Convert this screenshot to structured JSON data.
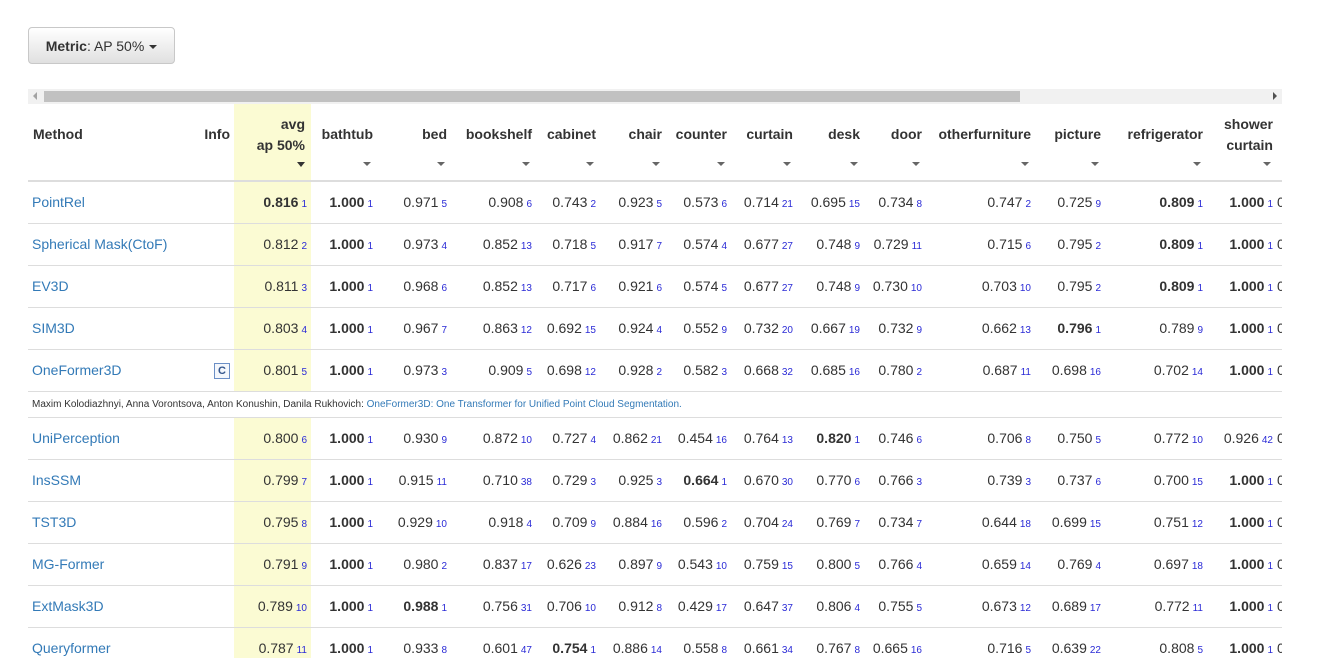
{
  "metric": {
    "label": "Metric",
    "value": ": AP 50%"
  },
  "headers": {
    "method": "Method",
    "info": "Info",
    "avg_l1": "avg",
    "avg_l2": "ap 50%",
    "bathtub": "bathtub",
    "bed": "bed",
    "bookshelf": "bookshelf",
    "cabinet": "cabinet",
    "chair": "chair",
    "counter": "counter",
    "curtain": "curtain",
    "desk": "desk",
    "door": "door",
    "otherfurniture": "otherfurniture",
    "picture": "picture",
    "refrigerator": "refrigerator",
    "shower_l1": "shower",
    "shower_l2": "curtain"
  },
  "rows": [
    {
      "method": "PointRel",
      "info": "",
      "avg": "0.816",
      "avg_r": "1",
      "bathtub": "1.000",
      "bathtub_r": "1",
      "bed": "0.971",
      "bed_r": "5",
      "bookshelf": "0.908",
      "bookshelf_r": "6",
      "cabinet": "0.743",
      "cabinet_r": "2",
      "chair": "0.923",
      "chair_r": "5",
      "counter": "0.573",
      "counter_r": "6",
      "curtain": "0.714",
      "curtain_r": "21",
      "desk": "0.695",
      "desk_r": "15",
      "door": "0.734",
      "door_r": "8",
      "otherfurniture": "0.747",
      "otherfurniture_r": "2",
      "picture": "0.725",
      "picture_r": "9",
      "refrigerator": "0.809",
      "refrigerator_r": "1",
      "shower": "1.000",
      "shower_r": "1",
      "cut": "0"
    },
    {
      "method": "Spherical Mask(CtoF)",
      "info": "",
      "avg": "0.812",
      "avg_r": "2",
      "bathtub": "1.000",
      "bathtub_r": "1",
      "bed": "0.973",
      "bed_r": "4",
      "bookshelf": "0.852",
      "bookshelf_r": "13",
      "cabinet": "0.718",
      "cabinet_r": "5",
      "chair": "0.917",
      "chair_r": "7",
      "counter": "0.574",
      "counter_r": "4",
      "curtain": "0.677",
      "curtain_r": "27",
      "desk": "0.748",
      "desk_r": "9",
      "door": "0.729",
      "door_r": "11",
      "otherfurniture": "0.715",
      "otherfurniture_r": "6",
      "picture": "0.795",
      "picture_r": "2",
      "refrigerator": "0.809",
      "refrigerator_r": "1",
      "shower": "1.000",
      "shower_r": "1",
      "cut": "0"
    },
    {
      "method": "EV3D",
      "info": "",
      "avg": "0.811",
      "avg_r": "3",
      "bathtub": "1.000",
      "bathtub_r": "1",
      "bed": "0.968",
      "bed_r": "6",
      "bookshelf": "0.852",
      "bookshelf_r": "13",
      "cabinet": "0.717",
      "cabinet_r": "6",
      "chair": "0.921",
      "chair_r": "6",
      "counter": "0.574",
      "counter_r": "5",
      "curtain": "0.677",
      "curtain_r": "27",
      "desk": "0.748",
      "desk_r": "9",
      "door": "0.730",
      "door_r": "10",
      "otherfurniture": "0.703",
      "otherfurniture_r": "10",
      "picture": "0.795",
      "picture_r": "2",
      "refrigerator": "0.809",
      "refrigerator_r": "1",
      "shower": "1.000",
      "shower_r": "1",
      "cut": "0"
    },
    {
      "method": "SIM3D",
      "info": "",
      "avg": "0.803",
      "avg_r": "4",
      "bathtub": "1.000",
      "bathtub_r": "1",
      "bed": "0.967",
      "bed_r": "7",
      "bookshelf": "0.863",
      "bookshelf_r": "12",
      "cabinet": "0.692",
      "cabinet_r": "15",
      "chair": "0.924",
      "chair_r": "4",
      "counter": "0.552",
      "counter_r": "9",
      "curtain": "0.732",
      "curtain_r": "20",
      "desk": "0.667",
      "desk_r": "19",
      "door": "0.732",
      "door_r": "9",
      "otherfurniture": "0.662",
      "otherfurniture_r": "13",
      "picture": "0.796",
      "picture_r": "1",
      "refrigerator": "0.789",
      "refrigerator_r": "9",
      "shower": "1.000",
      "shower_r": "1",
      "cut": "0"
    },
    {
      "method": "OneFormer3D",
      "info": "C",
      "avg": "0.801",
      "avg_r": "5",
      "bathtub": "1.000",
      "bathtub_r": "1",
      "bed": "0.973",
      "bed_r": "3",
      "bookshelf": "0.909",
      "bookshelf_r": "5",
      "cabinet": "0.698",
      "cabinet_r": "12",
      "chair": "0.928",
      "chair_r": "2",
      "counter": "0.582",
      "counter_r": "3",
      "curtain": "0.668",
      "curtain_r": "32",
      "desk": "0.685",
      "desk_r": "16",
      "door": "0.780",
      "door_r": "2",
      "otherfurniture": "0.687",
      "otherfurniture_r": "11",
      "picture": "0.698",
      "picture_r": "16",
      "refrigerator": "0.702",
      "refrigerator_r": "14",
      "shower": "1.000",
      "shower_r": "1",
      "cut": "0"
    },
    {
      "method": "UniPerception",
      "info": "",
      "avg": "0.800",
      "avg_r": "6",
      "bathtub": "1.000",
      "bathtub_r": "1",
      "bed": "0.930",
      "bed_r": "9",
      "bookshelf": "0.872",
      "bookshelf_r": "10",
      "cabinet": "0.727",
      "cabinet_r": "4",
      "chair": "0.862",
      "chair_r": "21",
      "counter": "0.454",
      "counter_r": "16",
      "curtain": "0.764",
      "curtain_r": "13",
      "desk": "0.820",
      "desk_r": "1",
      "door": "0.746",
      "door_r": "6",
      "otherfurniture": "0.706",
      "otherfurniture_r": "8",
      "picture": "0.750",
      "picture_r": "5",
      "refrigerator": "0.772",
      "refrigerator_r": "10",
      "shower": "0.926",
      "shower_r": "42",
      "cut": "0."
    },
    {
      "method": "InsSSM",
      "info": "",
      "avg": "0.799",
      "avg_r": "7",
      "bathtub": "1.000",
      "bathtub_r": "1",
      "bed": "0.915",
      "bed_r": "11",
      "bookshelf": "0.710",
      "bookshelf_r": "38",
      "cabinet": "0.729",
      "cabinet_r": "3",
      "chair": "0.925",
      "chair_r": "3",
      "counter": "0.664",
      "counter_r": "1",
      "curtain": "0.670",
      "curtain_r": "30",
      "desk": "0.770",
      "desk_r": "6",
      "door": "0.766",
      "door_r": "3",
      "otherfurniture": "0.739",
      "otherfurniture_r": "3",
      "picture": "0.737",
      "picture_r": "6",
      "refrigerator": "0.700",
      "refrigerator_r": "15",
      "shower": "1.000",
      "shower_r": "1",
      "cut": "0"
    },
    {
      "method": "TST3D",
      "info": "",
      "avg": "0.795",
      "avg_r": "8",
      "bathtub": "1.000",
      "bathtub_r": "1",
      "bed": "0.929",
      "bed_r": "10",
      "bookshelf": "0.918",
      "bookshelf_r": "4",
      "cabinet": "0.709",
      "cabinet_r": "9",
      "chair": "0.884",
      "chair_r": "16",
      "counter": "0.596",
      "counter_r": "2",
      "curtain": "0.704",
      "curtain_r": "24",
      "desk": "0.769",
      "desk_r": "7",
      "door": "0.734",
      "door_r": "7",
      "otherfurniture": "0.644",
      "otherfurniture_r": "18",
      "picture": "0.699",
      "picture_r": "15",
      "refrigerator": "0.751",
      "refrigerator_r": "12",
      "shower": "1.000",
      "shower_r": "1",
      "cut": "0"
    },
    {
      "method": "MG-Former",
      "info": "",
      "avg": "0.791",
      "avg_r": "9",
      "bathtub": "1.000",
      "bathtub_r": "1",
      "bed": "0.980",
      "bed_r": "2",
      "bookshelf": "0.837",
      "bookshelf_r": "17",
      "cabinet": "0.626",
      "cabinet_r": "23",
      "chair": "0.897",
      "chair_r": "9",
      "counter": "0.543",
      "counter_r": "10",
      "curtain": "0.759",
      "curtain_r": "15",
      "desk": "0.800",
      "desk_r": "5",
      "door": "0.766",
      "door_r": "4",
      "otherfurniture": "0.659",
      "otherfurniture_r": "14",
      "picture": "0.769",
      "picture_r": "4",
      "refrigerator": "0.697",
      "refrigerator_r": "18",
      "shower": "1.000",
      "shower_r": "1",
      "cut": "0."
    },
    {
      "method": "ExtMask3D",
      "info": "",
      "avg": "0.789",
      "avg_r": "10",
      "bathtub": "1.000",
      "bathtub_r": "1",
      "bed": "0.988",
      "bed_r": "1",
      "bookshelf": "0.756",
      "bookshelf_r": "31",
      "cabinet": "0.706",
      "cabinet_r": "10",
      "chair": "0.912",
      "chair_r": "8",
      "counter": "0.429",
      "counter_r": "17",
      "curtain": "0.647",
      "curtain_r": "37",
      "desk": "0.806",
      "desk_r": "4",
      "door": "0.755",
      "door_r": "5",
      "otherfurniture": "0.673",
      "otherfurniture_r": "12",
      "picture": "0.689",
      "picture_r": "17",
      "refrigerator": "0.772",
      "refrigerator_r": "11",
      "shower": "1.000",
      "shower_r": "1",
      "cut": "0."
    },
    {
      "method": "Queryformer",
      "info": "",
      "avg": "0.787",
      "avg_r": "11",
      "bathtub": "1.000",
      "bathtub_r": "1",
      "bed": "0.933",
      "bed_r": "8",
      "bookshelf": "0.601",
      "bookshelf_r": "47",
      "cabinet": "0.754",
      "cabinet_r": "1",
      "chair": "0.886",
      "chair_r": "14",
      "counter": "0.558",
      "counter_r": "8",
      "curtain": "0.661",
      "curtain_r": "34",
      "desk": "0.767",
      "desk_r": "8",
      "door": "0.665",
      "door_r": "16",
      "otherfurniture": "0.716",
      "otherfurniture_r": "5",
      "picture": "0.639",
      "picture_r": "22",
      "refrigerator": "0.808",
      "refrigerator_r": "5",
      "shower": "1.000",
      "shower_r": "1",
      "cut": "0"
    }
  ],
  "publication": {
    "authors": "Maxim Kolodiazhnyi, Anna Vorontsova, Anton Konushin, Danila Rukhovich: ",
    "title": "OneFormer3D: One Transformer for Unified Point Cloud Segmentation."
  },
  "colors": {
    "highlight": "#fbfbd3",
    "link": "#337ab7",
    "rank": "#2a2ad6"
  },
  "icons": {
    "sort": "sort-triangle-icon",
    "caret": "caret-down-icon"
  }
}
